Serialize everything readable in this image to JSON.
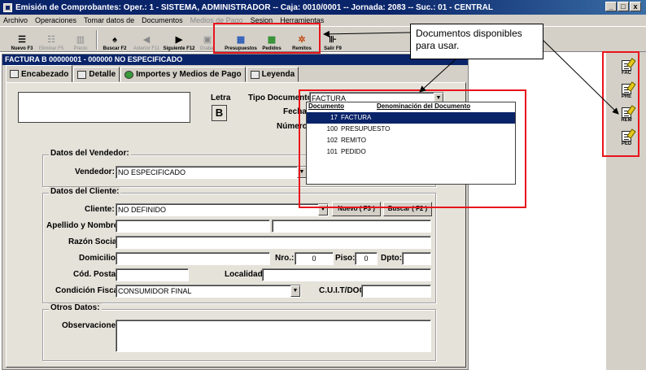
{
  "window": {
    "title": "Emisión de Comprobantes: Oper.: 1 - SISTEMA, ADMINISTRADOR  --  Caja: 0010/0001  --  Jornada: 2083  --  Suc.: 01 - CENTRAL",
    "min_label": "_",
    "max_label": "□",
    "close_label": "x"
  },
  "menu": {
    "archivo": "Archivo",
    "operaciones": "Operaciones",
    "tomar_datos": "Tomar datos de",
    "documentos": "Documentos",
    "medios_pago": "Medios de Pago",
    "sesion": "Sesion",
    "herramientas": "Herramientas"
  },
  "toolbar": {
    "nuevo": "Nuevo F3",
    "eliminar": "Eliminar F5",
    "precio": "Precio",
    "buscar": "Buscar F2",
    "anterior": "Anterior F11",
    "siguiente": "Siguiente F12",
    "grabar": "Grabar",
    "presupuestos": "Presupuestos",
    "pedidos": "Pedidos",
    "remitos": "Remitos",
    "salir": "Salir F9"
  },
  "form": {
    "title": "FACTURA B 00000001 - 000000 NO ESPECIFICADO",
    "tabs": {
      "encabezado": "Encabezado",
      "detalle": "Detalle",
      "importes": "Importes y Medios de Pago",
      "leyenda": "Leyenda"
    },
    "letra_label": "Letra",
    "letra_value": "B",
    "tipo_documento_label": "Tipo Documento:",
    "tipo_documento_value": "FACTURA",
    "fecha_label": "Fecha:",
    "numero_label": "Número:",
    "vendedor_group": "Datos del Vendedor:",
    "vendedor_label": "Vendedor:",
    "vendedor_value": "NO ESPECIFICADO",
    "cliente_group": "Datos del Cliente:",
    "cliente_label": "Cliente:",
    "cliente_value": "NO DEFINIDO",
    "nuevo_button": "Nuevo ( F3 )",
    "buscar_button": "Buscar ( F2 )",
    "apellido_label": "Apellido y Nombres:",
    "razon_label": "Razón Social:",
    "domicilio_label": "Domicilio:",
    "nro_label": "Nro.:",
    "nro_value": "0",
    "piso_label": "Piso:",
    "piso_value": "0",
    "dpto_label": "Dpto:",
    "cp_label": "Cód. Postal:",
    "localidad_label": "Localidad:",
    "condicion_label": "Condición Fiscal:",
    "condicion_value": "CONSUMIDOR FINAL",
    "cuit_label": "C.U.I.T/DOC:",
    "otros_group": "Otros Datos:",
    "observaciones_label": "Observaciones:"
  },
  "dropdown": {
    "col_documento": "Documento",
    "col_denominacion": "Denominación del Documento",
    "rows": [
      {
        "code": "17",
        "name": "FACTURA"
      },
      {
        "code": "100",
        "name": "PRESUPUESTO"
      },
      {
        "code": "102",
        "name": "REMITO"
      },
      {
        "code": "101",
        "name": "PEDIDO"
      }
    ]
  },
  "callout": {
    "line1": "Documentos disponibles",
    "line2": "para usar."
  },
  "side_icons": {
    "fac": "FAC",
    "pre": "PRE",
    "rem": "REM",
    "ped": "PED"
  },
  "colors": {
    "titlebar": "#0a246a",
    "highlight": "#e8141c",
    "face": "#d4d0c8"
  }
}
